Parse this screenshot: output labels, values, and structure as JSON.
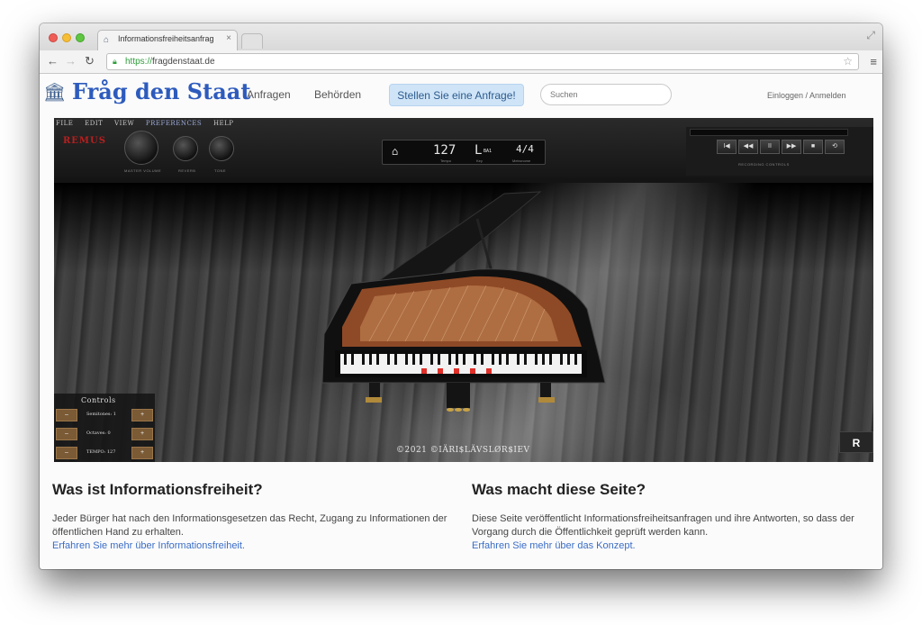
{
  "browser": {
    "tab_title": "Informationsfreiheitsanfrag",
    "tab_close": "×",
    "url_scheme": "https://",
    "url_host": "fragdenstaat.de"
  },
  "site": {
    "logo_text": "Fråg den Staat",
    "nav": [
      "Anfragen",
      "Behörden"
    ],
    "cta_label": "Stellen Sie eine Anfrage!",
    "search_placeholder": "Suchen",
    "login_label": "Einloggen / Anmelden"
  },
  "app": {
    "menu": [
      "FILE",
      "EDIT",
      "VIEW",
      "PREFERENCES",
      "HELP"
    ],
    "brand": "REMUS",
    "knob_labels": [
      "MASTER VOLUME",
      "REVERB",
      "TONE"
    ],
    "lcd": {
      "tempo_value": "127",
      "tempo_label": "Tempo",
      "key_value": "L",
      "key_sub": "BA1",
      "key_label": "Key",
      "meter_value": "4/4",
      "meter_label": "Metronome"
    },
    "transport_buttons": [
      "I◀",
      "◀◀",
      "II",
      "▶▶",
      "■",
      "⟲"
    ],
    "transport_label": "RECORDING CONTROLS",
    "controls": {
      "title": "Controls",
      "rows": [
        {
          "label": "Semitones: 1",
          "minus": "–",
          "plus": "+"
        },
        {
          "label": "Octaves: 0",
          "minus": "–",
          "plus": "+"
        },
        {
          "label": "TEMPO: 127",
          "minus": "–",
          "plus": "+"
        }
      ]
    },
    "copyright": "©2021 ©IÄRI$LÄVSLØR$IEV",
    "corner_logo": "R"
  },
  "content": {
    "left": {
      "title": "Was ist Informationsfreiheit?",
      "text": "Jeder Bürger hat nach den Informationsgesetzen das Recht, Zugang zu Informationen der öffentlichen Hand zu erhalten.",
      "link": "Erfahren Sie mehr über Informationsfreiheit."
    },
    "right": {
      "title": "Was macht diese Seite?",
      "text": "Diese Seite veröffentlicht Informationsfreiheitsanfragen und ihre Antworten, so dass der Vorgang durch die Öffentlichkeit geprüft werden kann.",
      "link": "Erfahren Sie mehr über das Konzept."
    }
  }
}
